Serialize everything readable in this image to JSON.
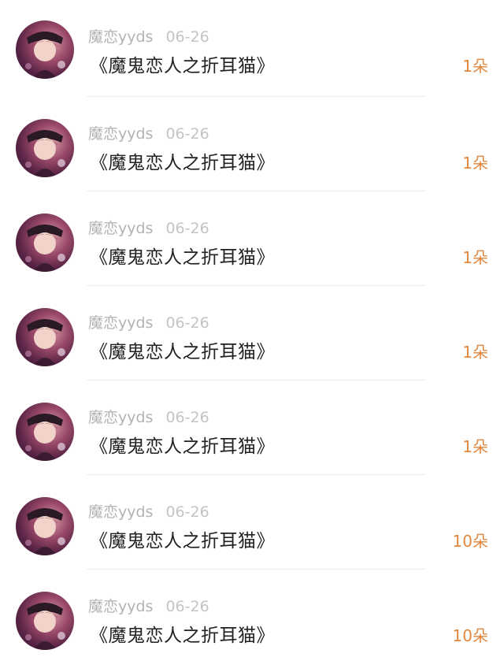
{
  "rows": [
    {
      "username": "魔恋yyds",
      "date": "06-26",
      "gift": "《魔鬼恋人之折耳猫》",
      "count": "1朵"
    },
    {
      "username": "魔恋yyds",
      "date": "06-26",
      "gift": "《魔鬼恋人之折耳猫》",
      "count": "1朵"
    },
    {
      "username": "魔恋yyds",
      "date": "06-26",
      "gift": "《魔鬼恋人之折耳猫》",
      "count": "1朵"
    },
    {
      "username": "魔恋yyds",
      "date": "06-26",
      "gift": "《魔鬼恋人之折耳猫》",
      "count": "1朵"
    },
    {
      "username": "魔恋yyds",
      "date": "06-26",
      "gift": "《魔鬼恋人之折耳猫》",
      "count": "1朵"
    },
    {
      "username": "魔恋yyds",
      "date": "06-26",
      "gift": "《魔鬼恋人之折耳猫》",
      "count": "10朵"
    },
    {
      "username": "魔恋yyds",
      "date": "06-26",
      "gift": "《魔鬼恋人之折耳猫》",
      "count": "10朵"
    }
  ],
  "colors": {
    "count": "#e0883e",
    "meta": "#b3b3b3",
    "title": "#222222"
  },
  "icons": {
    "avatar": "anime-character-avatar"
  }
}
